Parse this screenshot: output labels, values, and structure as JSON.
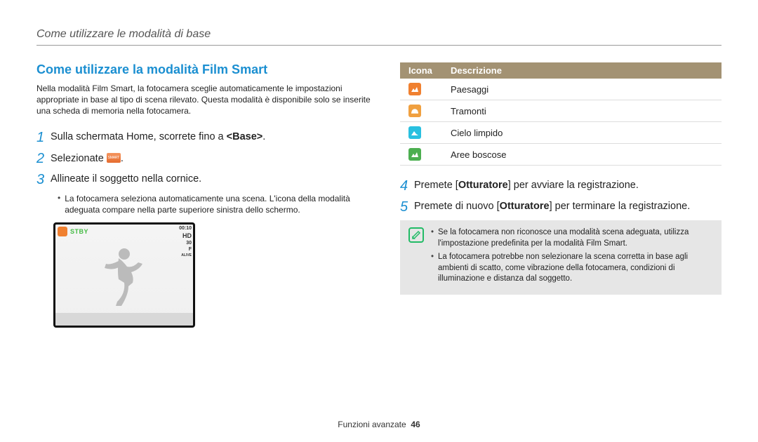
{
  "header": "Come utilizzare le modalità di base",
  "heading": "Come utilizzare la modalità Film Smart",
  "intro": "Nella modalità Film Smart, la fotocamera sceglie automaticamente le impostazioni appropriate in base al tipo di scena rilevato. Questa modalità è disponibile solo se inserite una scheda di memoria nella fotocamera.",
  "steps": {
    "s1": {
      "n": "1",
      "pre": "Sulla schermata Home, scorrete fino a ",
      "bold": "<Base>",
      "post": "."
    },
    "s2": {
      "n": "2",
      "pre": "Selezionate ",
      "post": "."
    },
    "s3": {
      "n": "3",
      "text": "Allineate il soggetto nella cornice."
    },
    "s3b": "La fotocamera seleziona automaticamente una scena. L'icona della modalità adeguata compare nella parte superiore sinistra dello schermo.",
    "s4": {
      "n": "4",
      "pre": "Premete [",
      "bold": "Otturatore",
      "post": "] per avviare la registrazione."
    },
    "s5": {
      "n": "5",
      "pre": "Premete di nuovo [",
      "bold": "Otturatore",
      "post": "] per terminare la registrazione."
    }
  },
  "preview": {
    "stby": "STBY",
    "timer": "00:10",
    "hd": "HD",
    "fps": "30",
    "f": "F",
    "alive": "ALIVE"
  },
  "table": {
    "h_icon": "Icona",
    "h_desc": "Descrizione",
    "rows": [
      {
        "label": "Paesaggi",
        "bg": "#f08030",
        "glyph": "landscape"
      },
      {
        "label": "Tramonti",
        "bg": "#f0a040",
        "glyph": "sunset"
      },
      {
        "label": "Cielo limpido",
        "bg": "#29c0e0",
        "glyph": "sky"
      },
      {
        "label": "Aree boscose",
        "bg": "#4caf50",
        "glyph": "forest"
      }
    ]
  },
  "notes": {
    "n1": "Se la fotocamera non riconosce una modalità scena adeguata, utilizza l'impostazione predefinita per la modalità Film Smart.",
    "n2": "La fotocamera potrebbe non selezionare la scena corretta in base agli ambienti di scatto, come vibrazione della fotocamera, condizioni di illuminazione e distanza dal soggetto."
  },
  "footer": {
    "section": "Funzioni avanzate",
    "page": "46"
  }
}
